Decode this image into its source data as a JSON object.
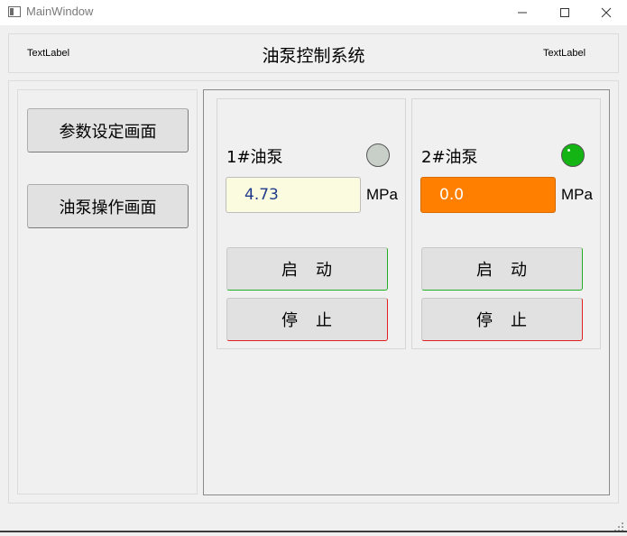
{
  "window": {
    "title": "MainWindow",
    "controls": [
      "minimize-icon",
      "maximize-icon",
      "close-icon"
    ]
  },
  "header": {
    "left_label": "TextLabel",
    "title": "油泵控制系统",
    "right_label": "TextLabel"
  },
  "nav": {
    "params_label": "参数设定画面",
    "pump_label": "油泵操作画面"
  },
  "pumps": [
    {
      "name": "1#油泵",
      "pressure": "4.73",
      "unit": "MPa",
      "status_color": "#c8cfc8",
      "start_label": "启　动",
      "stop_label": "停　止"
    },
    {
      "name": "2#油泵",
      "pressure": "0.0",
      "unit": "MPa",
      "status_color": "#14b414",
      "start_label": "启　动",
      "stop_label": "停　止"
    }
  ],
  "colors": {
    "pump2_pressure_bg": "#ff7f00",
    "start_border": "#22b022",
    "stop_border": "#e02020"
  }
}
